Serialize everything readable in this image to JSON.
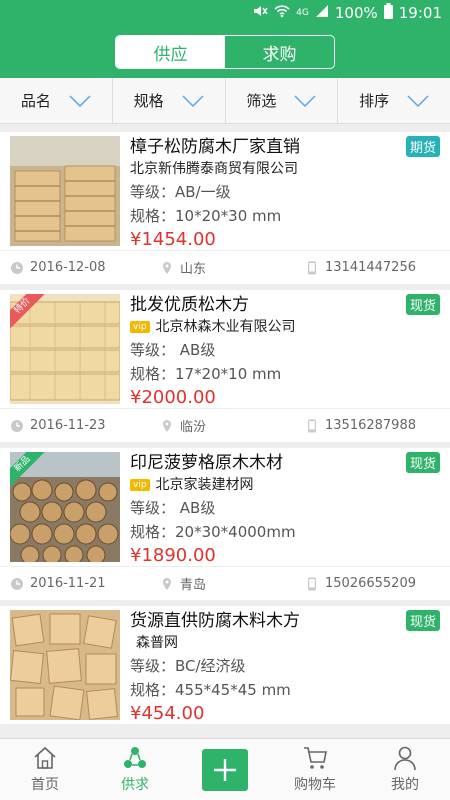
{
  "status_bar": {
    "battery": "100%",
    "time": "19:01",
    "network": "4G"
  },
  "segment": {
    "supply": "供应",
    "demand": "求购"
  },
  "filters": [
    "品名",
    "规格",
    "筛选",
    "排序"
  ],
  "listings": [
    {
      "title": "樟子松防腐木厂家直销",
      "company": "北京新伟腾泰商贸有限公司",
      "vip": false,
      "grade": "等级：AB/一级",
      "spec": "规格：10*20*30 mm",
      "price": "¥1454.00",
      "badge": "期货",
      "date": "2016-12-08",
      "location": "山东",
      "phone": "13141447256",
      "corner": ""
    },
    {
      "title": "批发优质松木方",
      "company": "北京林森木业有限公司",
      "vip": true,
      "grade": "等级： AB级",
      "spec": "规格：17*20*10 mm",
      "price": "¥2000.00",
      "badge": "现货",
      "date": "2016-11-23",
      "location": "临汾",
      "phone": "13516287988",
      "corner": "特价"
    },
    {
      "title": "印尼菠萝格原木木材",
      "company": "北京家装建材网",
      "vip": true,
      "grade": "等级： AB级",
      "spec": "规格：20*30*4000mm",
      "price": "¥1890.00",
      "badge": "现货",
      "date": "2016-11-21",
      "location": "青岛",
      "phone": "15026655209",
      "corner": "新品"
    },
    {
      "title": "货源直供防腐木料木方",
      "company": "森普网",
      "vip": false,
      "grade": "等级：BC/经济级",
      "spec": "规格：455*45*45 mm",
      "price": "¥454.00",
      "badge": "现货",
      "date": "",
      "location": "",
      "phone": "",
      "corner": ""
    }
  ],
  "vip_label": "vip",
  "tabs": {
    "home": "首页",
    "supply": "供求",
    "cart": "购物车",
    "mine": "我的"
  },
  "colors": {
    "brand": "#2fb36a",
    "price": "#e0332e",
    "futures_badge": "#25b3b8"
  }
}
